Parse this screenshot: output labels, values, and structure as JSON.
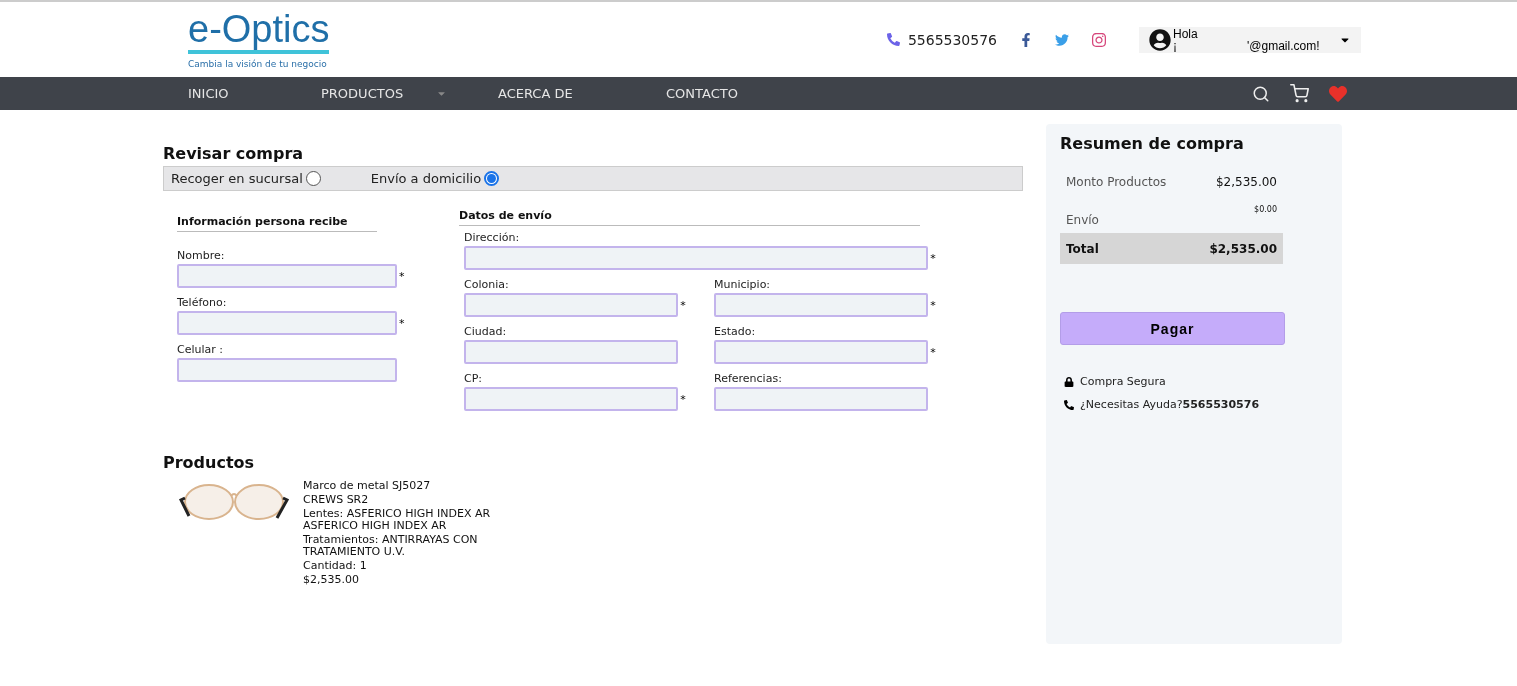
{
  "header": {
    "logo": {
      "title": "e-Optics",
      "tagline": "Cambia la visión de tu negocio"
    },
    "phone": "5565530576",
    "user": {
      "greeting": "Hola",
      "email_start": "¡",
      "email_end": "'@gmail.com!"
    }
  },
  "nav": {
    "items": [
      {
        "label": "INICIO",
        "kind": "link"
      },
      {
        "label": "PRODUCTOS",
        "kind": "dropdown"
      },
      {
        "label": "ACERCA DE",
        "kind": "link"
      },
      {
        "label": "CONTACTO",
        "kind": "link"
      }
    ]
  },
  "checkout": {
    "title": "Revisar compra",
    "delivery_options": [
      {
        "label": "Recoger en sucursal",
        "selected": false
      },
      {
        "label": "Envío a domicilio",
        "selected": true
      }
    ],
    "recipient": {
      "title": "Información persona recibe",
      "fields": [
        {
          "label": "Nombre:",
          "mark": "*"
        },
        {
          "label": "Teléfono:",
          "mark": "*"
        },
        {
          "label": "Celular :"
        }
      ]
    },
    "shipping": {
      "title": "Datos de envío",
      "fields": [
        {
          "label": "Dirección:",
          "mark": "*",
          "kind": "wide"
        },
        {
          "label": "Colonia:",
          "mark": "*",
          "kind": "half"
        },
        {
          "label": "Municipio:",
          "mark": "*",
          "kind": "half"
        },
        {
          "label": "Ciudad:",
          "kind": "half"
        },
        {
          "label": "Estado:",
          "mark": "*",
          "kind": "half"
        },
        {
          "label": "CP:",
          "mark": "*",
          "kind": "half"
        },
        {
          "label": "Referencias:",
          "kind": "half"
        }
      ]
    }
  },
  "products": {
    "title": "Productos",
    "items": [
      {
        "kind": "picture",
        "lines": [
          "Marco de metal SJ5027",
          "CREWS SR2",
          "Lentes: ASFERICO HIGH INDEX AR ASFERICO HIGH INDEX AR",
          "Tratamientos: ANTIRRAYAS CON TRATAMIENTO U.V.",
          "Cantidad: 1",
          "$2,535.00"
        ]
      }
    ]
  },
  "summary": {
    "title": "Resumen de compra",
    "rows": [
      {
        "label": "Monto Productos",
        "value": "$2,535.00",
        "kind": "normal"
      },
      {
        "label": "Envío",
        "value": "$0.00",
        "kind": "small"
      },
      {
        "label": "Total",
        "value": "$2,535.00",
        "kind": "total"
      }
    ],
    "pay_button": "Pagar",
    "secure": "Compra Segura",
    "help": {
      "text": "¿Necesitas Ayuda?",
      "phone": "5565530576"
    }
  }
}
